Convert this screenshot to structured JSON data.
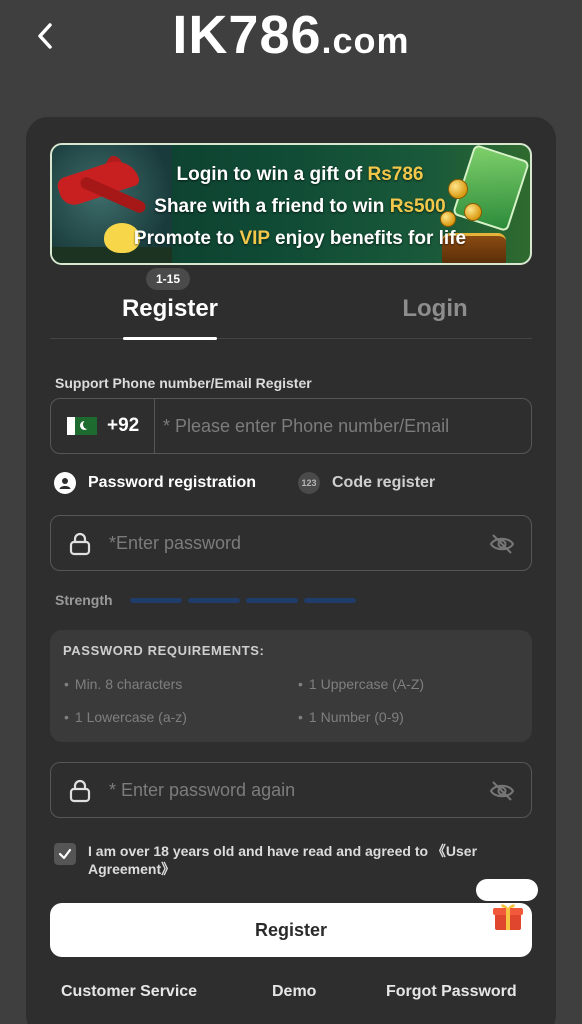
{
  "header": {
    "back_icon": "chevron-left-icon",
    "brand_main": "IK786",
    "brand_suffix": ".com"
  },
  "banner": {
    "line1_prefix": "Login to win a gift of ",
    "line1_highlight": "Rs786",
    "line2_prefix": "Share with a friend to win ",
    "line2_highlight": "Rs500",
    "line3_prefix": "Promote to ",
    "line3_highlight": "VIP",
    "line3_suffix": " enjoy benefits for life"
  },
  "badge": "1-15",
  "tabs": [
    {
      "label": "Register",
      "active": true
    },
    {
      "label": "Login",
      "active": false
    }
  ],
  "form": {
    "section_label": "Support Phone number/Email Register",
    "country_code": "+92",
    "country_flag_icon": "pakistan-flag-icon",
    "phone_placeholder": "* Please enter Phone number/Email",
    "modes": [
      {
        "label": "Password registration",
        "selected": true
      },
      {
        "label": "Code register",
        "icon_text": "123",
        "selected": false
      }
    ],
    "password_placeholder": "*Enter password",
    "strength_label": "Strength",
    "requirements": {
      "title": "PASSWORD REQUIREMENTS:",
      "items": [
        "Min. 8 characters",
        "1 Uppercase (A-Z)",
        "1 Lowercase (a-z)",
        "1 Number (0-9)"
      ]
    },
    "password_again_placeholder": "* Enter password again",
    "agree_text": "I am over 18 years old and have read and agreed to 《User Agreement》",
    "agree_checked": true,
    "submit_label": "Register"
  },
  "footer": {
    "links": [
      "Customer Service",
      "Demo",
      "Forgot Password"
    ]
  },
  "colors": {
    "page_bg": "#3f3f3f",
    "card_bg": "#2e2e2e",
    "highlight": "#f3c84a",
    "strength_bar": "#1f3c6b"
  }
}
